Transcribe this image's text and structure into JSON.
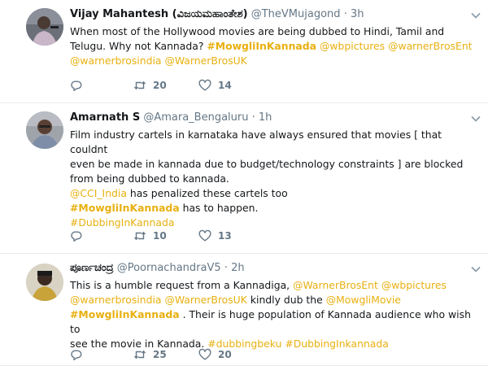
{
  "colors": {
    "hashtag": "#e8b010",
    "muted": "#657786",
    "text": "#14171a",
    "divider": "#e6ecf0"
  },
  "tweets": [
    {
      "name": "Vijay Mahantesh (ವಿಜಯಮಹಾಂತೇಶ)",
      "handle": "@TheVMujagond",
      "dot": "·",
      "time": "3h",
      "lines": [
        [
          {
            "t": "When most of the Hollywood movies are being dubbed to Hindi, Tamil and"
          }
        ],
        [
          {
            "t": "Telugu. Why not Kannada? "
          },
          {
            "t": "#MowgliInKannada",
            "c": "ht"
          },
          {
            "t": " "
          },
          {
            "t": "@wbpictures",
            "c": "mention"
          },
          {
            "t": " "
          },
          {
            "t": "@warnerBrosEnt",
            "c": "mention"
          }
        ],
        [
          {
            "t": "@warnerbrosindia",
            "c": "mention"
          },
          {
            "t": " "
          },
          {
            "t": "@WarnerBrosUK",
            "c": "mention"
          }
        ]
      ],
      "reply_icon": "reply-icon",
      "retweet_icon": "retweet-icon",
      "like_icon": "heart-icon",
      "retweets": "20",
      "likes": "14"
    },
    {
      "name": "Amarnath S",
      "handle": "@Amara_Bengaluru",
      "dot": "·",
      "time": "1h",
      "lines": [
        [
          {
            "t": "Film industry cartels in karnataka have always ensured that movies [ that couldnt"
          }
        ],
        [
          {
            "t": "even be made in kannada due to budget/technology constraints ] are blocked"
          }
        ],
        [
          {
            "t": "from being dubbed to kannada."
          }
        ],
        [
          {
            "t": "@CCI_India",
            "c": "mention"
          },
          {
            "t": " has penalized these cartels too"
          }
        ],
        [
          {
            "t": "#MowgliInKannada",
            "c": "ht"
          },
          {
            "t": " has to happen."
          }
        ],
        [
          {
            "t": "#DubbingInKannada",
            "c": "ht-light"
          }
        ]
      ],
      "reply_icon": "reply-icon",
      "retweet_icon": "retweet-icon",
      "like_icon": "heart-icon",
      "retweets": "10",
      "likes": "13"
    },
    {
      "name": "ಪೂರ್ಣಚಂದ್ರ",
      "handle": "@PoornachandraV5",
      "dot": "·",
      "time": "2h",
      "lines": [
        [
          {
            "t": "This is a humble request from a Kannadiga, "
          },
          {
            "t": "@WarnerBrosEnt",
            "c": "mention"
          },
          {
            "t": " "
          },
          {
            "t": "@wbpictures",
            "c": "mention"
          }
        ],
        [
          {
            "t": "@warnerbrosindia",
            "c": "mention"
          },
          {
            "t": " "
          },
          {
            "t": "@WarnerBrosUK",
            "c": "mention"
          },
          {
            "t": " kindly dub the "
          },
          {
            "t": "@MowgliMovie",
            "c": "mention"
          }
        ],
        [
          {
            "t": "#MowgliInKannada",
            "c": "ht"
          },
          {
            "t": " . Their is huge population of Kannada audience who wish to"
          }
        ],
        [
          {
            "t": "see the movie in Kannada. "
          },
          {
            "t": "#dubbingbeku",
            "c": "ht-light"
          },
          {
            "t": " "
          },
          {
            "t": "#DubbingInkannada",
            "c": "ht-light"
          }
        ]
      ],
      "reply_icon": "reply-icon",
      "retweet_icon": "retweet-icon",
      "like_icon": "heart-icon",
      "retweets": "25",
      "likes": "20"
    }
  ]
}
